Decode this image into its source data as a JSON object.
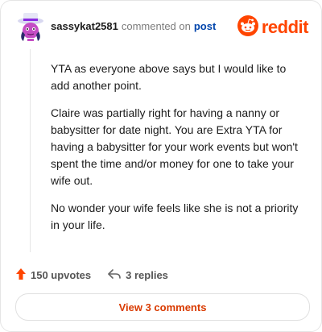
{
  "comment": {
    "username": "sassykat2581",
    "action_text": "commented on",
    "post_link": "post",
    "paragraphs": [
      "YTA as everyone above says but I would like to add another point.",
      "Claire was partially right for having a nanny or babysitter for date night. You are Extra YTA for having a babysitter for your work events but won't spent the time and/or money for one to take your wife out.",
      "No wonder your wife feels like she is not a priority in your life."
    ]
  },
  "brand": {
    "name": "reddit",
    "color": "#ff4500"
  },
  "actions": {
    "upvotes_label": "150 upvotes",
    "replies_label": "3 replies"
  },
  "footer": {
    "view_comments_label": "View 3 comments"
  },
  "icons": {
    "avatar": "avatar-icon",
    "brand": "reddit-snoo-icon",
    "upvote": "upvote-arrow-icon",
    "reply": "reply-arrow-icon"
  }
}
